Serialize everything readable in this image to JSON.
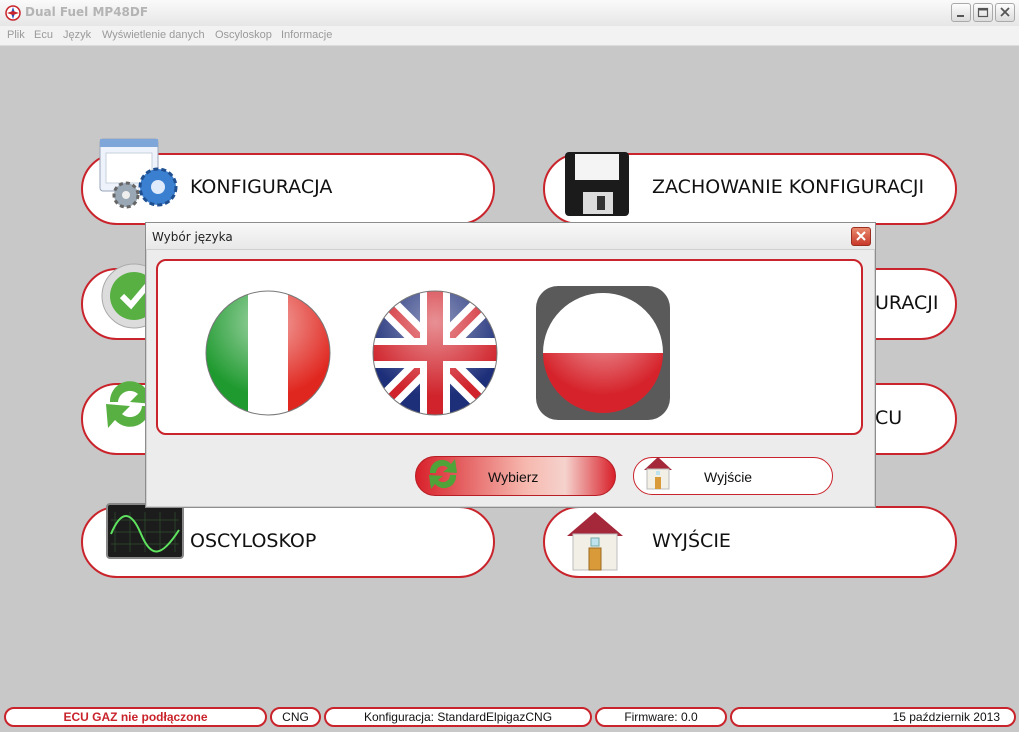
{
  "window": {
    "title": "Dual Fuel MP48DF",
    "min_icon": "minimize-icon",
    "max_icon": "maximize-icon",
    "close_icon": "close-icon"
  },
  "menu": [
    "Plik",
    "Ecu",
    "Język",
    "Wyświetlenie danych",
    "Oscyloskop",
    "Informacje"
  ],
  "main_buttons": {
    "konfiguracja": "KONFIGURACJA",
    "zachowanie": "ZACHOWANIE KONFIGURACJI",
    "row2_right_partial": "URACJI",
    "row3_right_partial": "CU",
    "oscyloskop": "OSCYLOSKOP",
    "wyjscie": "WYJŚCIE"
  },
  "dialog": {
    "title": "Wybór języka",
    "flags": [
      "italian-flag-icon",
      "uk-flag-icon",
      "polish-flag-icon"
    ],
    "select_label": "Wybierz",
    "exit_label": "Wyjście"
  },
  "status": {
    "connection": "ECU GAZ nie podłączone",
    "fuel": "CNG",
    "config": "Konfiguracja: StandardElpigazCNG",
    "firmware": "Firmware: 0.0",
    "date": "15 październik 2013"
  },
  "colors": {
    "accent": "#c9232b",
    "background": "#c8c8c8",
    "status_alert": "#c9232b"
  }
}
